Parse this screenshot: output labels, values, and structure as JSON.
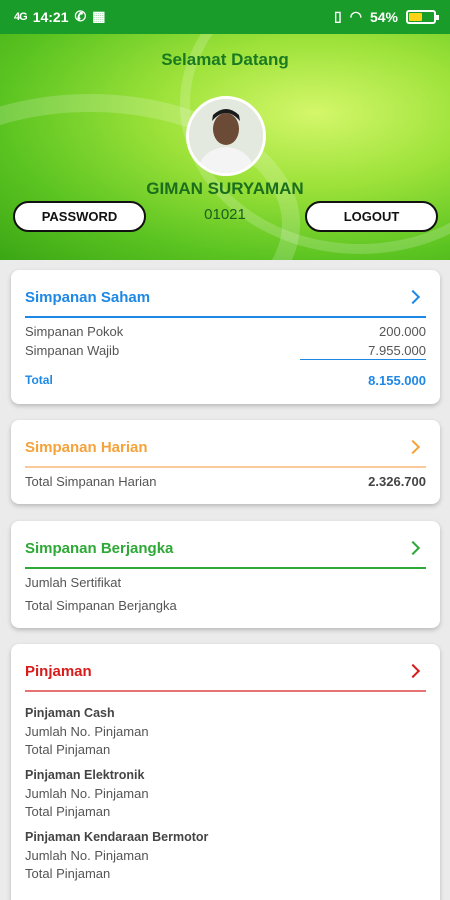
{
  "status_bar": {
    "time": "14:21",
    "signal": "4G",
    "battery_percent": "54%",
    "battery_level": 0.54
  },
  "header": {
    "title": "Selamat Datang",
    "user_name": "GIMAN SURYAMAN",
    "user_id": "01021",
    "password_button": "PASSWORD",
    "logout_button": "LOGOUT"
  },
  "colors": {
    "saham": "#1e88e5",
    "harian": "#f5a23a",
    "berjangka": "#2ea836",
    "pinjaman": "#d81b1b"
  },
  "saham": {
    "title": "Simpanan Saham",
    "rows": [
      {
        "label": "Simpanan Pokok",
        "value": "200.000"
      },
      {
        "label": "Simpanan Wajib",
        "value": "7.955.000"
      }
    ],
    "total_label": "Total",
    "total_value": "8.155.000"
  },
  "harian": {
    "title": "Simpanan Harian",
    "row_label": "Total Simpanan Harian",
    "row_value": "2.326.700"
  },
  "berjangka": {
    "title": "Simpanan Berjangka",
    "rows": [
      "Jumlah Sertifikat",
      "Total Simpanan Berjangka"
    ]
  },
  "pinjaman": {
    "title": "Pinjaman",
    "groups": [
      {
        "name": "Pinjaman Cash",
        "line1": "Jumlah No. Pinjaman",
        "line2": "Total Pinjaman"
      },
      {
        "name": "Pinjaman Elektronik",
        "line1": "Jumlah No. Pinjaman",
        "line2": "Total Pinjaman"
      },
      {
        "name": "Pinjaman Kendaraan Bermotor",
        "line1": "Jumlah No. Pinjaman",
        "line2": "Total Pinjaman"
      }
    ]
  }
}
